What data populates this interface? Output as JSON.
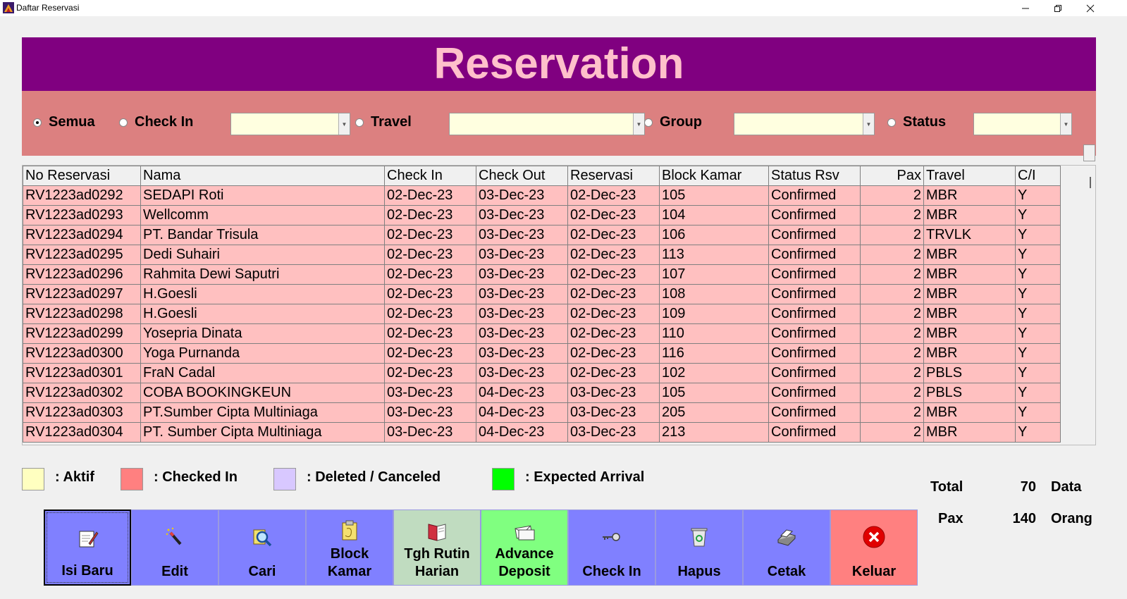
{
  "window": {
    "title": "Daftar Reservasi"
  },
  "header": {
    "title": "Reservation"
  },
  "filters": [
    {
      "label": "Semua",
      "checked": true
    },
    {
      "label": "Check In",
      "checked": false
    },
    {
      "label": "Travel",
      "checked": false
    },
    {
      "label": "Group",
      "checked": false
    },
    {
      "label": "Status",
      "checked": false
    }
  ],
  "table": {
    "columns": [
      "No Reservasi",
      "Nama",
      "Check In",
      "Check Out",
      "Reservasi",
      "Block Kamar",
      "Status Rsv",
      "Pax",
      "Travel",
      "C/I"
    ],
    "rows": [
      [
        "RV1223ad0292",
        "SEDAPI Roti",
        "02-Dec-23",
        "03-Dec-23",
        "02-Dec-23",
        "105",
        "Confirmed",
        "2",
        "MBR",
        "Y"
      ],
      [
        "RV1223ad0293",
        "Wellcomm",
        "02-Dec-23",
        "03-Dec-23",
        "02-Dec-23",
        "104",
        "Confirmed",
        "2",
        "MBR",
        "Y"
      ],
      [
        "RV1223ad0294",
        "PT. Bandar Trisula",
        "02-Dec-23",
        "03-Dec-23",
        "02-Dec-23",
        "106",
        "Confirmed",
        "2",
        "TRVLK",
        "Y"
      ],
      [
        "RV1223ad0295",
        "Dedi Suhairi",
        "02-Dec-23",
        "03-Dec-23",
        "02-Dec-23",
        "113",
        "Confirmed",
        "2",
        "MBR",
        "Y"
      ],
      [
        "RV1223ad0296",
        "Rahmita Dewi Saputri",
        "02-Dec-23",
        "03-Dec-23",
        "02-Dec-23",
        "107",
        "Confirmed",
        "2",
        "MBR",
        "Y"
      ],
      [
        "RV1223ad0297",
        "H.Goesli",
        "02-Dec-23",
        "03-Dec-23",
        "02-Dec-23",
        "108",
        "Confirmed",
        "2",
        "MBR",
        "Y"
      ],
      [
        "RV1223ad0298",
        "H.Goesli",
        "02-Dec-23",
        "03-Dec-23",
        "02-Dec-23",
        "109",
        "Confirmed",
        "2",
        "MBR",
        "Y"
      ],
      [
        "RV1223ad0299",
        "Yosepria Dinata",
        "02-Dec-23",
        "03-Dec-23",
        "02-Dec-23",
        "110",
        "Confirmed",
        "2",
        "MBR",
        "Y"
      ],
      [
        "RV1223ad0300",
        "Yoga Purnanda",
        "02-Dec-23",
        "03-Dec-23",
        "02-Dec-23",
        "116",
        "Confirmed",
        "2",
        "MBR",
        "Y"
      ],
      [
        "RV1223ad0301",
        "FraN Cadal",
        "02-Dec-23",
        "03-Dec-23",
        "02-Dec-23",
        "102",
        "Confirmed",
        "2",
        "PBLS",
        "Y"
      ],
      [
        "RV1223ad0302",
        "COBA BOOKINGKEUN",
        "03-Dec-23",
        "04-Dec-23",
        "03-Dec-23",
        "105",
        "Confirmed",
        "2",
        "PBLS",
        "Y"
      ],
      [
        "RV1223ad0303",
        "PT.Sumber Cipta Multiniaga",
        "03-Dec-23",
        "04-Dec-23",
        "03-Dec-23",
        "205",
        "Confirmed",
        "2",
        "MBR",
        "Y"
      ],
      [
        "RV1223ad0304",
        "PT. Sumber Cipta Multiniaga",
        "03-Dec-23",
        "04-Dec-23",
        "03-Dec-23",
        "213",
        "Confirmed",
        "2",
        "MBR",
        "Y"
      ]
    ]
  },
  "legend": [
    {
      "label": ": Aktif",
      "color": "#ffffc0"
    },
    {
      "label": ": Checked In",
      "color": "#ff8080"
    },
    {
      "label": ": Deleted / Canceled",
      "color": "#d8c8ff"
    },
    {
      "label": ": Expected Arrival",
      "color": "#00ff00"
    }
  ],
  "totals": {
    "total_label": "Total",
    "total_value": "70",
    "total_unit": "Data",
    "pax_label": "Pax",
    "pax_value": "140",
    "pax_unit": "Orang"
  },
  "buttons": [
    {
      "label": "Isi Baru",
      "icon": "new-document-icon",
      "color": "#8080ff"
    },
    {
      "label": "Edit",
      "icon": "magic-wand-icon",
      "color": "#8080ff"
    },
    {
      "label": "Cari",
      "icon": "magnifier-icon",
      "color": "#8080ff"
    },
    {
      "label": "Block\nKamar",
      "icon": "clipboard-icon",
      "color": "#8080ff"
    },
    {
      "label": "Tgh Rutin\nHarian",
      "icon": "book-icon",
      "color": "#c0dcc0"
    },
    {
      "label": "Advance\nDeposit",
      "icon": "envelope-icon",
      "color": "#80ff80"
    },
    {
      "label": "Check In",
      "icon": "key-icon",
      "color": "#8080ff"
    },
    {
      "label": "Hapus",
      "icon": "recycle-bin-icon",
      "color": "#8080ff"
    },
    {
      "label": "Cetak",
      "icon": "printer-icon",
      "color": "#8080ff"
    },
    {
      "label": "Keluar",
      "icon": "close-circle-icon",
      "color": "#ff8080"
    }
  ]
}
